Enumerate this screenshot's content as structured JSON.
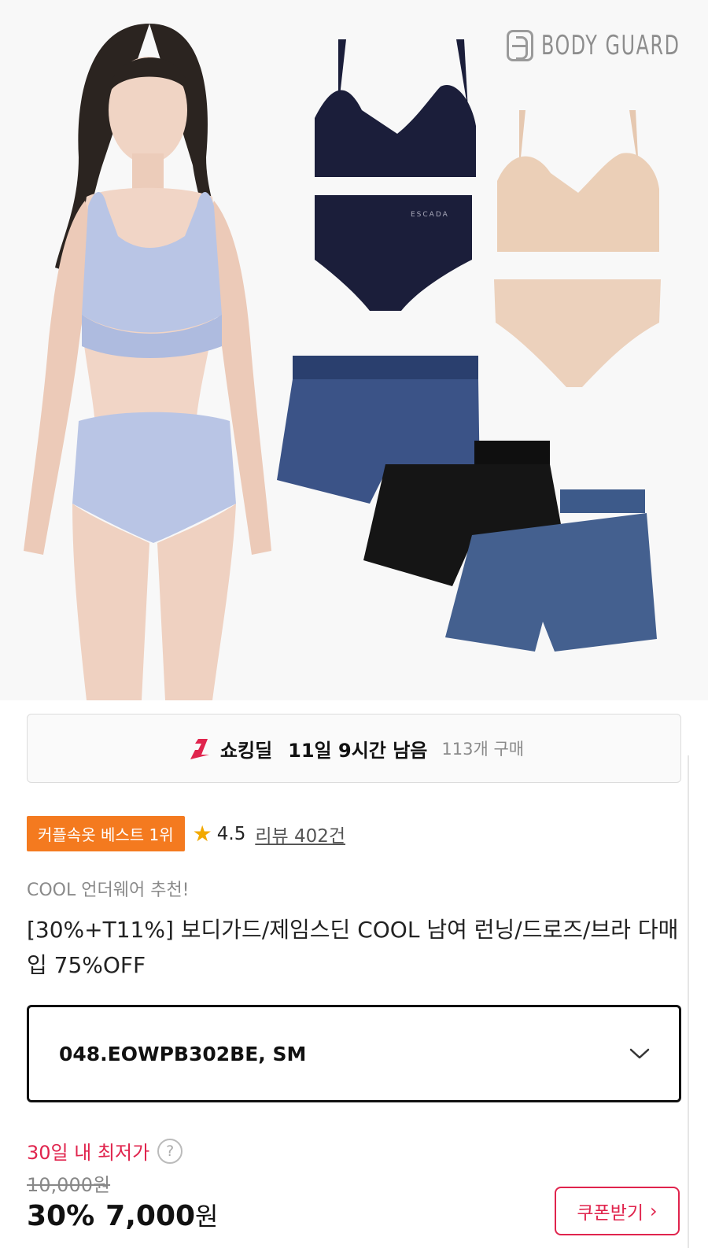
{
  "hero": {
    "brand_name": "BODY GUARD",
    "waistband_text": "ESCADA"
  },
  "deal": {
    "label": "쇼킹딜",
    "time_left": "11일 9시간 남음",
    "purchase_count": "113개 구매"
  },
  "rank": {
    "badge": "커플속옷 베스트 1위",
    "rating": "4.5",
    "reviews": "리뷰 402건"
  },
  "product": {
    "subtitle": "COOL 언더웨어 추천!",
    "title": "[30%+T11%] 보디가드/제임스딘 COOL 남여 런닝/드로즈/브라 다매입 75%OFF"
  },
  "option": {
    "selected": "048.EOWPB302BE, SM"
  },
  "price": {
    "lowest_label": "30일 내 최저가",
    "help_icon": "?",
    "original": "10,000원",
    "discount": "30%",
    "sale_amount": "7,000",
    "sale_currency": "원"
  },
  "coupon": {
    "label": "쿠폰받기",
    "arrow": "›"
  },
  "colors": {
    "accent_red": "#e0244d",
    "rank_orange": "#f47a1f",
    "star": "#f2a900"
  }
}
